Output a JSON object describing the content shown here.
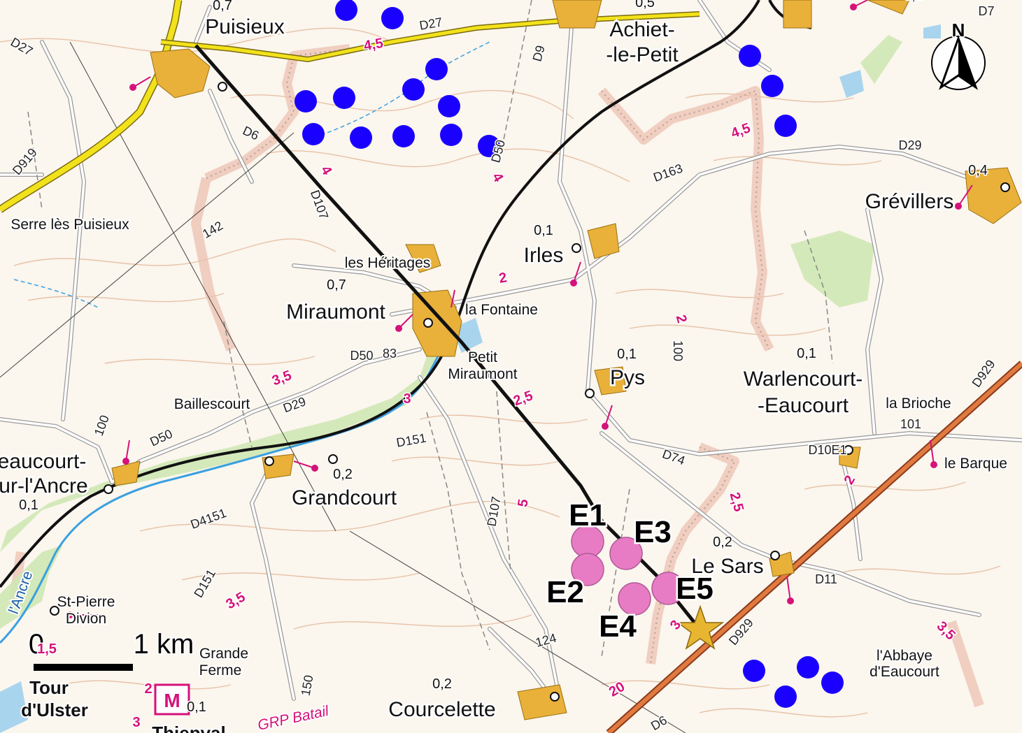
{
  "places": {
    "puisieux": "Puisieux",
    "achiet": "Achiet-",
    "achiet2": "-le-Petit",
    "serre": "Serre lès Puisieux",
    "irles": "Irles",
    "heritages": "les Héritages",
    "miraumont": "Miraumont",
    "fontaine": "la Fontaine",
    "petit_miraumont_1": "Petit",
    "petit_miraumont_2": "Miraumont",
    "pys": "Pys",
    "warlencourt1": "Warlencourt-",
    "warlencourt2": "-Eaucourt",
    "brioche": "la Brioche",
    "barque": "le Barque",
    "baillescourt": "Baillescourt",
    "beaucourt1": "eaucourt-",
    "beaucourt2": "ur-l'Ancre",
    "grandcourt": "Grandcourt",
    "le_sars": "Le Sars",
    "st_pierre1": "St-Pierre",
    "st_pierre2": "Divion",
    "grande_ferme1": "Grande",
    "grande_ferme2": "Ferme",
    "tour1": "Tour",
    "tour2": "d'Ulster",
    "thiepval": "Thiepval",
    "courcelette": "Courcelette",
    "abbaye1": "l'Abbaye",
    "abbaye2": "d'Eaucourt",
    "grevillers": "Grévillers",
    "ancre_river": "l'Ancre",
    "grp": "GRP Batail"
  },
  "roads": [
    "D27",
    "D27",
    "D7",
    "D9",
    "D6",
    "D50",
    "D919",
    "D107",
    "D163",
    "D29",
    "D50",
    "D29",
    "D50",
    "D151",
    "D107",
    "D151",
    "D4151",
    "D74",
    "D10E1",
    "D929",
    "D11",
    "D929",
    "D6"
  ],
  "populations": [
    "0,7",
    "0,5",
    "0,1",
    "0,7",
    "0,1",
    "0,1",
    "0,4",
    "0,2",
    "0,1",
    "0,2",
    "0,1",
    "0,2",
    "0,1"
  ],
  "gradients": [
    "4,5",
    "4",
    "4",
    "4,5",
    "2",
    "2,5",
    "3,5",
    "3",
    "5",
    "2",
    "2,5",
    "3,5",
    "2",
    "3",
    "3,5",
    "20",
    "1,5",
    "2",
    "3"
  ],
  "elevations": [
    "142",
    "83",
    "100",
    "124",
    "100",
    "101",
    "150"
  ],
  "turbines": [
    "E1",
    "E2",
    "E3",
    "E4",
    "E5"
  ],
  "scale": {
    "zero": "0",
    "one": "1 km"
  },
  "north": "N",
  "colors": {
    "blue_turbines": "#1a00ff",
    "project_turbines": "#e87cc4",
    "star": "#e8b531",
    "main_road": "#f2e21b",
    "railway_highspeed": "#d86a3c",
    "border_zone": "#e8b8a8"
  },
  "icons": [
    "north-arrow-icon",
    "star-icon",
    "church-icon",
    "museum-icon"
  ],
  "museum_label": "M"
}
